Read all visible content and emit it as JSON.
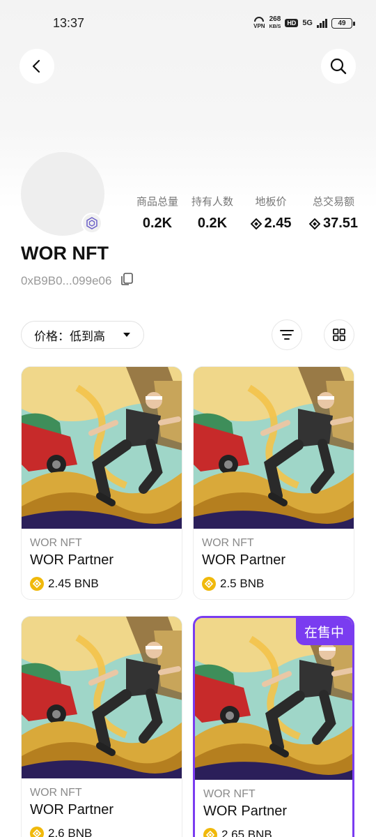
{
  "status_bar": {
    "time": "13:37",
    "vpn": "VPN",
    "speed_value": "268",
    "speed_unit": "KB/S",
    "hd": "HD",
    "network": "5G",
    "battery": "49"
  },
  "header": {
    "back_icon": "chevron-left-icon",
    "search_icon": "search-icon"
  },
  "collection": {
    "name": "WOR NFT",
    "address": "0xB9B0...099e06",
    "chain_icon": "bnb-chain-icon",
    "stats": [
      {
        "label": "商品总量",
        "value": "0.2K",
        "has_coin": false
      },
      {
        "label": "持有人数",
        "value": "0.2K",
        "has_coin": false
      },
      {
        "label": "地板价",
        "value": "2.45",
        "has_coin": true
      },
      {
        "label": "总交易额",
        "value": "37.51",
        "has_coin": true
      }
    ]
  },
  "toolbar": {
    "sort_label": "价格：低到高",
    "filter_icon": "filter-icon",
    "grid_icon": "grid-view-icon"
  },
  "items": [
    {
      "collection": "WOR NFT",
      "name": "WOR Partner",
      "price": "2.45 BNB",
      "on_sale": false
    },
    {
      "collection": "WOR NFT",
      "name": "WOR Partner",
      "price": "2.5 BNB",
      "on_sale": false
    },
    {
      "collection": "WOR NFT",
      "name": "WOR Partner",
      "price": "2.6 BNB",
      "on_sale": false
    },
    {
      "collection": "WOR NFT",
      "name": "WOR Partner",
      "price": "2.65 BNB",
      "on_sale": true,
      "badge": "在售中"
    }
  ],
  "colors": {
    "accent": "#7a3cf0",
    "bnb": "#f0b90b"
  }
}
